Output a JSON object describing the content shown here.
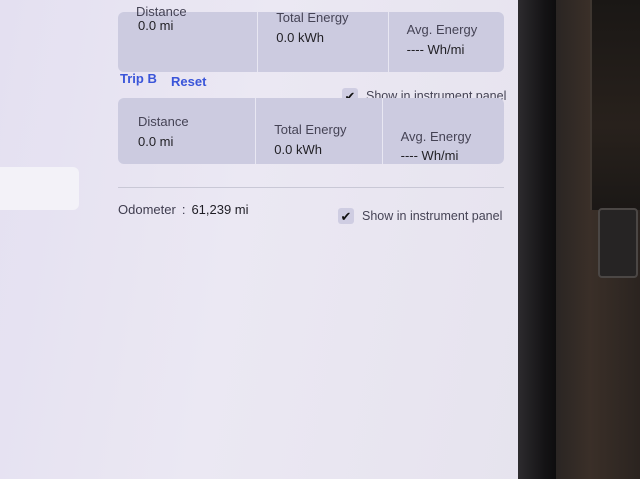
{
  "tripA": {
    "distance_label": "Distance",
    "distance_value": "0.0 mi",
    "energy_label": "Total Energy",
    "energy_value": "0.0 kWh",
    "avg_label": "Avg. Energy",
    "avg_value": "---- Wh/mi",
    "show_label": "Show in instrument panel"
  },
  "tripB": {
    "title": "Trip B",
    "reset_label": "Reset",
    "show_label": "Show in instrument panel",
    "show_checked": true,
    "distance_label": "Distance",
    "distance_value": "0.0 mi",
    "energy_label": "Total Energy",
    "energy_value": "0.0 kWh",
    "avg_label": "Avg. Energy",
    "avg_value": "---- Wh/mi"
  },
  "odometer": {
    "label": "Odometer",
    "separator": ":",
    "value": "61,239 mi",
    "show_label": "Show in instrument panel",
    "show_checked": true
  },
  "icons": {
    "checkmark": "checkmark-icon"
  },
  "colors": {
    "link_blue": "#3a55d9",
    "panel_bg": "#cccbe0"
  }
}
